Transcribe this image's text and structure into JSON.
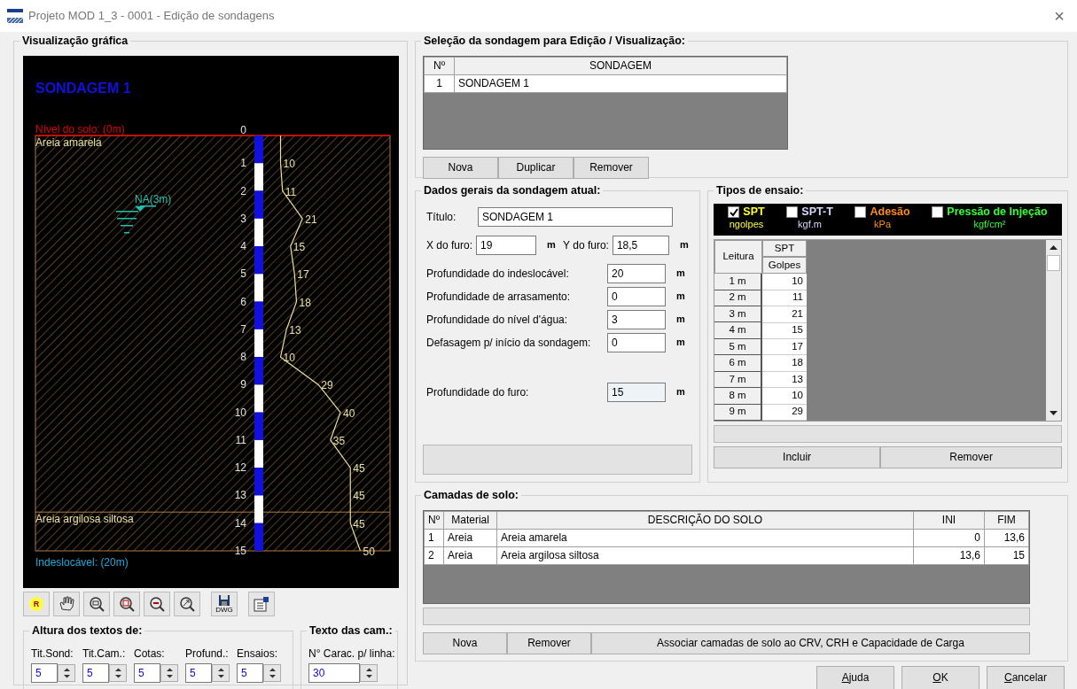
{
  "window": {
    "title": "Projeto MOD 1_3 - 0001 - Edição de sondagens",
    "close": "×"
  },
  "graphic": {
    "title": "Visualização gráfica",
    "drawing": {
      "sounding_title": "SONDAGEM 1",
      "ground_level": "Nível do solo: (0m)",
      "water_level": "NA(3m)",
      "bedrock": "Indeslocável: (20m)",
      "layers": [
        "Areia amarela",
        "Areia argilosa siltosa"
      ],
      "chart_data": {
        "type": "line",
        "orientation": "horizontal",
        "x": [
          1,
          2,
          3,
          4,
          5,
          6,
          7,
          8,
          9,
          10,
          11,
          12,
          13,
          14,
          15
        ],
        "yticks": [
          0,
          1,
          2,
          3,
          4,
          5,
          6,
          7,
          8,
          9,
          10,
          11,
          12,
          13,
          14,
          15
        ],
        "ylim": [
          15,
          0
        ],
        "ref_lines": [
          {
            "axis": "y",
            "value": 13.6
          }
        ],
        "series": [
          {
            "color": "#e8e0a0",
            "values": [
              10,
              11,
              21,
              15,
              17,
              18,
              13,
              10,
              29,
              40,
              35,
              45,
              45,
              45,
              50
            ]
          }
        ],
        "data_labels": true
      }
    },
    "toolbar": [
      {
        "kind": "text",
        "label": "R"
      },
      {
        "kind": "hand"
      },
      {
        "kind": "zoom-window"
      },
      {
        "kind": "zoom-all"
      },
      {
        "kind": "zoom-out"
      },
      {
        "kind": "zoom-pan"
      },
      {
        "kind": "save",
        "label": "DWG"
      },
      {
        "kind": "properties"
      }
    ],
    "text_heights": {
      "title": "Altura dos textos de:",
      "fields": [
        {
          "label": "Tit.Sond:",
          "value": "5"
        },
        {
          "label": "Tit.Cam.:",
          "value": "5"
        },
        {
          "label": "Cotas:",
          "value": "5"
        },
        {
          "label": "Profund.:",
          "value": "5"
        },
        {
          "label": "Ensaios:",
          "value": "5"
        }
      ]
    },
    "layer_text": {
      "title": "Texto das cam.:",
      "fields": [
        {
          "label": "N° Carac. p/ linha:",
          "value": "30"
        }
      ]
    }
  },
  "selection": {
    "title": "Seleção da sondagem para Edição / Visualização:",
    "columns": [
      "Nº",
      "SONDAGEM"
    ],
    "rows": [
      [
        "1",
        "SONDAGEM 1"
      ]
    ],
    "buttons": [
      "Nova",
      "Duplicar",
      "Remover"
    ]
  },
  "general": {
    "title": "Dados gerais da sondagem atual:",
    "fields": [
      {
        "kind": "title",
        "label": "Título:",
        "value": "SONDAGEM 1"
      },
      {
        "kind": "pair",
        "label": "X do furo:",
        "value": "19",
        "unit": "m",
        "label2": "Y do furo:",
        "value2": "18,5",
        "unit2": "m"
      },
      {
        "kind": "depth",
        "label": "Profundidade do indeslocável:",
        "value": "20",
        "unit": "m"
      },
      {
        "kind": "depth",
        "label": "Profundidade de arrasamento:",
        "value": "0",
        "unit": "m"
      },
      {
        "kind": "depth",
        "label": "Profundidade do nível d'água:",
        "value": "3",
        "unit": "m"
      },
      {
        "kind": "depth",
        "label": "Defasagem p/ início da sondagem:",
        "value": "0",
        "unit": "m"
      },
      {
        "kind": "readonly",
        "label": "Profundidade do furo:",
        "value": "15",
        "unit": "m"
      }
    ]
  },
  "tests": {
    "title": "Tipos de ensaio:",
    "types": [
      {
        "label": "SPT",
        "unit": "ngolpes",
        "checked": true,
        "color": "#ffff33"
      },
      {
        "label": "SPT-T",
        "unit": "kgf.m",
        "checked": false,
        "color": "#d8d8ff"
      },
      {
        "label": "Adesão",
        "unit": "kPa",
        "checked": false,
        "color": "#ff8c1a"
      },
      {
        "label": "Pressão de Injeção",
        "unit": "kgf/cm²",
        "checked": false,
        "color": "#33ff33"
      }
    ],
    "grid": {
      "row_header": "Leitura",
      "column": "SPT",
      "subcolumn": "Golpes",
      "rows": [
        {
          "label": "1 m",
          "value": "10"
        },
        {
          "label": "2 m",
          "value": "11"
        },
        {
          "label": "3 m",
          "value": "21"
        },
        {
          "label": "4 m",
          "value": "15"
        },
        {
          "label": "5 m",
          "value": "17"
        },
        {
          "label": "6 m",
          "value": "18"
        },
        {
          "label": "7 m",
          "value": "13"
        },
        {
          "label": "8 m",
          "value": "10"
        },
        {
          "label": "9 m",
          "value": "29"
        }
      ]
    },
    "buttons": [
      "Incluir",
      "Remover"
    ]
  },
  "layers": {
    "title": "Camadas de solo:",
    "columns": [
      "Nº",
      "Material",
      "DESCRIÇÃO DO SOLO",
      "INI",
      "FIM"
    ],
    "rows": [
      [
        "1",
        "Areia",
        "Areia amarela",
        "0",
        "13,6"
      ],
      [
        "2",
        "Areia",
        "Areia argilosa siltosa",
        "13,6",
        "15"
      ]
    ],
    "buttons": [
      "Nova",
      "Remover",
      "Associar camadas de solo ao CRV,  CRH e Capacidade de Carga"
    ]
  },
  "footer_buttons": [
    "Ajuda",
    "OK",
    "Cancelar"
  ]
}
